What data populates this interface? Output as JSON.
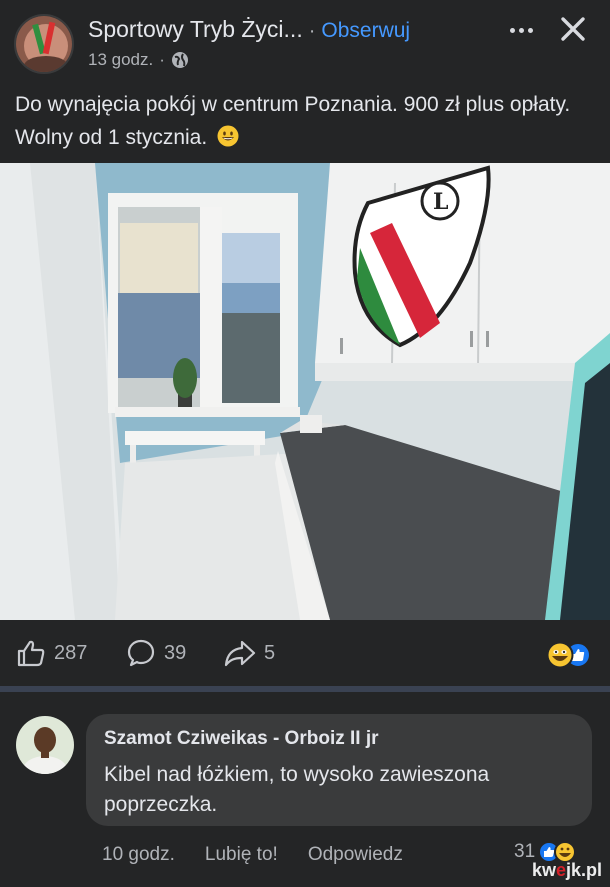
{
  "post": {
    "page_name": "Sportowy Tryb Życi...",
    "separator": "·",
    "follow_label": "Obserwuj",
    "time": "13 godz.",
    "time_dot": "·",
    "text": "Do wynajęcia pokój w centrum Poznania. 900 zł plus opłaty. Wolny od 1 stycznia.",
    "icons": {
      "privacy": "globe-icon",
      "more": "more-options-icon",
      "close": "close-icon",
      "emoji": "grinning-emoji"
    }
  },
  "stats": {
    "likes": "287",
    "comments": "39",
    "shares": "5",
    "icons": {
      "like": "thumbs-up-icon",
      "comment": "comment-bubble-icon",
      "share": "share-arrow-icon"
    }
  },
  "comment": {
    "author": "Szamot Cziweikas - Orboiz II jr",
    "text": "Kibel nad łóżkiem, to wysoko zawieszona poprzeczka.",
    "time": "10 godz.",
    "like_label": "Lubię to!",
    "reply_label": "Odpowiedz",
    "reaction_count": "31"
  },
  "watermark": {
    "prefix": "kw",
    "accent": "e",
    "suffix": "jk.pl"
  },
  "colors": {
    "background": "#242526",
    "bubble": "#3a3b3c",
    "link": "#4599ff",
    "text": "#e4e6eb",
    "muted": "#b0b3b8"
  }
}
